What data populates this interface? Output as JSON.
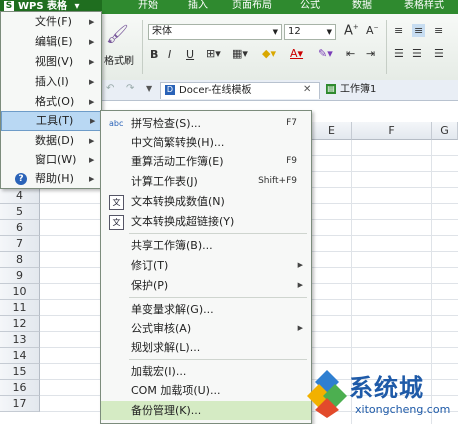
{
  "app": {
    "name": "WPS 表格",
    "logo_letter": "S"
  },
  "tabs": [
    "开始",
    "插入",
    "页面布局",
    "公式",
    "数据",
    "表格样式"
  ],
  "ribbon": {
    "format_painter": "格式刷",
    "font_name": "宋体",
    "font_size": "12",
    "bold": "B",
    "italic": "I",
    "underline": "U"
  },
  "docbar": {
    "template_tab": "Docer-在线模板",
    "workbook_tab": "工作簿1"
  },
  "grid": {
    "columns": [
      "E",
      "F",
      "G"
    ],
    "rows": [
      "4",
      "5",
      "6",
      "7",
      "8",
      "9",
      "10",
      "11",
      "12",
      "13",
      "14",
      "15",
      "16",
      "17"
    ]
  },
  "menu": {
    "items": [
      {
        "label": "文件",
        "key": "(F)"
      },
      {
        "label": "编辑",
        "key": "(E)"
      },
      {
        "label": "视图",
        "key": "(V)"
      },
      {
        "label": "插入",
        "key": "(I)"
      },
      {
        "label": "格式",
        "key": "(O)"
      },
      {
        "label": "工具",
        "key": "(T)"
      },
      {
        "label": "数据",
        "key": "(D)"
      },
      {
        "label": "窗口",
        "key": "(W)"
      },
      {
        "label": "帮助",
        "key": "(H)"
      }
    ]
  },
  "tools_menu": {
    "spell_check": {
      "label": "拼写检查(S)...",
      "shortcut": "F7",
      "icon": "abc"
    },
    "chinese_convert": {
      "label": "中文简繁转换(H)..."
    },
    "recalc_workbook": {
      "label": "重算活动工作簿(E)",
      "shortcut": "F9"
    },
    "calc_sheet": {
      "label": "计算工作表(J)",
      "shortcut": "Shift+F9"
    },
    "text_to_number": {
      "label": "文本转换成数值(N)"
    },
    "text_to_link": {
      "label": "文本转换成超链接(Y)"
    },
    "share_workbook": {
      "label": "共享工作簿(B)..."
    },
    "revisions": {
      "label": "修订(T)"
    },
    "protect": {
      "label": "保护(P)"
    },
    "variable_solver": {
      "label": "单变量求解(G)..."
    },
    "formula_audit": {
      "label": "公式审核(A)"
    },
    "planning_solver": {
      "label": "规划求解(L)..."
    },
    "load_macro": {
      "label": "加载宏(I)..."
    },
    "com_addins": {
      "label": "COM 加载项(U)..."
    },
    "backup_mgmt": {
      "label": "备份管理(K)..."
    }
  },
  "watermark": {
    "brand": "系统城",
    "url": "xitongcheng.com"
  },
  "colors": {
    "title_green": "#2f8a2f",
    "highlight_blue": "#b9d8f3",
    "hover_green": "#d5ebc4"
  }
}
